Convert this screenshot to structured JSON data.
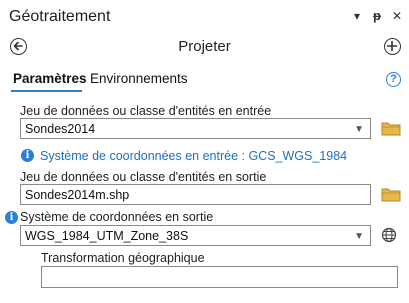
{
  "pane": {
    "title": "Géotraitement",
    "menu_glyph": "▾",
    "pin_glyph": "ᵽ",
    "close_glyph": "✕"
  },
  "tool": {
    "title": "Projeter"
  },
  "tabs": [
    {
      "label": "Paramètres",
      "active": true
    },
    {
      "label": "Environnements",
      "active": false
    }
  ],
  "help_glyph": "?",
  "params": {
    "input_label": "Jeu de données ou classe d'entités en entrée",
    "input_value": "Sondes2014",
    "input_cs_info": "Système de coordonnées en entrée : GCS_WGS_1984",
    "output_label": "Jeu de données ou classe d'entités en sortie",
    "output_value": "Sondes2014m.shp",
    "output_cs_label": "Système de coordonnées en sortie",
    "output_cs_value": "WGS_1984_UTM_Zone_38S",
    "geo_transform_label": "Transformation géographique",
    "geo_transform_value": ""
  },
  "icons": {
    "back": "back-arrow-icon",
    "add": "add-icon",
    "help": "help-icon",
    "folder": "folder-icon",
    "info": "info-icon",
    "globe": "globe-icon",
    "dropdown": "chevron-down-icon"
  },
  "colors": {
    "accent": "#2f7ec7",
    "info_text": "#1c6fbd",
    "folder": "#e8b84a"
  }
}
